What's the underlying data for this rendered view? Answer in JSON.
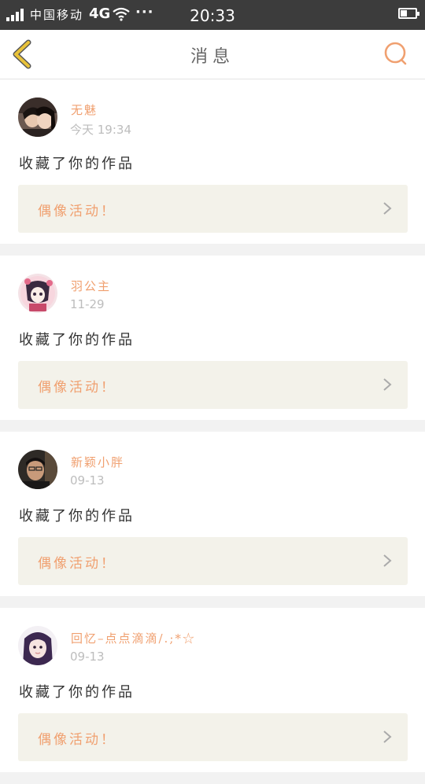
{
  "status_bar": {
    "carrier": "中国移动",
    "network": "4G",
    "more": "···",
    "time": "20:33",
    "battery_level": 0.45,
    "signal_icon": "signal-bars-icon",
    "wifi_icon": "wifi-icon"
  },
  "header": {
    "title": "消息",
    "back_icon": "chevron-left-icon",
    "search_icon": "search-icon"
  },
  "colors": {
    "accent": "#f0a070",
    "back_arrow": "#e8c23a",
    "status_bar_bg": "#3c3c3c",
    "activity_bg": "#f3f2ea"
  },
  "messages": [
    {
      "username": "无魅",
      "time": "今天 19:34",
      "action": "收藏了你的作品",
      "activity": "偶像活动！"
    },
    {
      "username": "羽公主",
      "time": "11-29",
      "action": "收藏了你的作品",
      "activity": "偶像活动！"
    },
    {
      "username": "新颖小胖",
      "time": "09-13",
      "action": "收藏了你的作品",
      "activity": "偶像活动！"
    },
    {
      "username": "回忆–点点滴滴/.;*☆",
      "time": "09-13",
      "action": "收藏了你的作品",
      "activity": "偶像活动！"
    }
  ]
}
